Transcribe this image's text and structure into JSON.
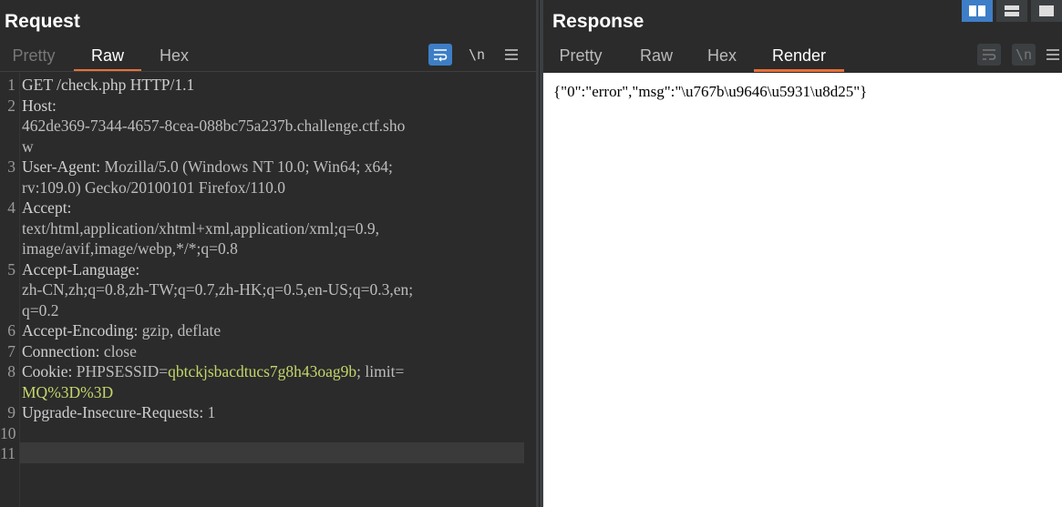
{
  "request": {
    "title": "Request",
    "tabs": [
      "Pretty",
      "Raw",
      "Hex"
    ],
    "active_tab": "Raw",
    "toolbar": {
      "newline_label": "\\n",
      "menu_icon": "hamburger-icon",
      "wrap_icon": "wrap-icon"
    },
    "lines": [
      {
        "n": "1",
        "rows": [
          [
            {
              "t": "GET /check.php HTTP/1.1",
              "c": "hname"
            }
          ]
        ]
      },
      {
        "n": "2",
        "rows": [
          [
            {
              "t": "Host:",
              "c": "hname"
            }
          ],
          [
            {
              "t": "462de369-7344-4657-8cea-088bc75a237b.challenge.ctf.sho",
              "c": "hval"
            }
          ],
          [
            {
              "t": "w",
              "c": "hval"
            }
          ]
        ]
      },
      {
        "n": "3",
        "rows": [
          [
            {
              "t": "User-Agent: ",
              "c": "hname"
            },
            {
              "t": "Mozilla/5.0 (Windows NT 10.0; Win64; x64;",
              "c": "hval"
            }
          ],
          [
            {
              "t": "rv:109.0) Gecko/20100101 Firefox/110.0",
              "c": "hval"
            }
          ]
        ]
      },
      {
        "n": "4",
        "rows": [
          [
            {
              "t": "Accept:",
              "c": "hname"
            }
          ],
          [
            {
              "t": "text/html,application/xhtml+xml,application/xml;q=0.9,",
              "c": "hval"
            }
          ],
          [
            {
              "t": "image/avif,image/webp,*/*;q=0.8",
              "c": "hval"
            }
          ]
        ]
      },
      {
        "n": "5",
        "rows": [
          [
            {
              "t": "Accept-Language:",
              "c": "hname"
            }
          ],
          [
            {
              "t": "zh-CN,zh;q=0.8,zh-TW;q=0.7,zh-HK;q=0.5,en-US;q=0.3,en;",
              "c": "hval"
            }
          ],
          [
            {
              "t": "q=0.2",
              "c": "hval"
            }
          ]
        ]
      },
      {
        "n": "6",
        "rows": [
          [
            {
              "t": "Accept-Encoding: ",
              "c": "hname"
            },
            {
              "t": "gzip, deflate",
              "c": "hval"
            }
          ]
        ]
      },
      {
        "n": "7",
        "rows": [
          [
            {
              "t": "Connection: ",
              "c": "hname"
            },
            {
              "t": "close",
              "c": "hval"
            }
          ]
        ]
      },
      {
        "n": "8",
        "rows": [
          [
            {
              "t": "Cookie: ",
              "c": "hname"
            },
            {
              "t": "PHPSESSID=",
              "c": "hval"
            },
            {
              "t": "qbtckjsbacdtucs7g8h43oag9b",
              "c": "cval"
            },
            {
              "t": "; limit=",
              "c": "hval"
            }
          ],
          [
            {
              "t": "MQ%3D%3D",
              "c": "cval"
            }
          ]
        ]
      },
      {
        "n": "9",
        "rows": [
          [
            {
              "t": "Upgrade-Insecure-Requests: ",
              "c": "hname"
            },
            {
              "t": "1",
              "c": "hval"
            }
          ]
        ]
      },
      {
        "n": "10",
        "rows": [
          []
        ]
      },
      {
        "n": "11",
        "rows": [
          []
        ]
      }
    ]
  },
  "response": {
    "title": "Response",
    "tabs": [
      "Pretty",
      "Raw",
      "Hex",
      "Render"
    ],
    "active_tab": "Render",
    "toolbar": {
      "newline_label": "\\n"
    },
    "render_body": "{\"0\":\"error\",\"msg\":\"\\u767b\\u9646\\u5931\\u8d25\"}"
  },
  "colors": {
    "accent": "#e8703a",
    "button_blue": "#3d7ec7",
    "cookie_value": "#c3d66b"
  }
}
